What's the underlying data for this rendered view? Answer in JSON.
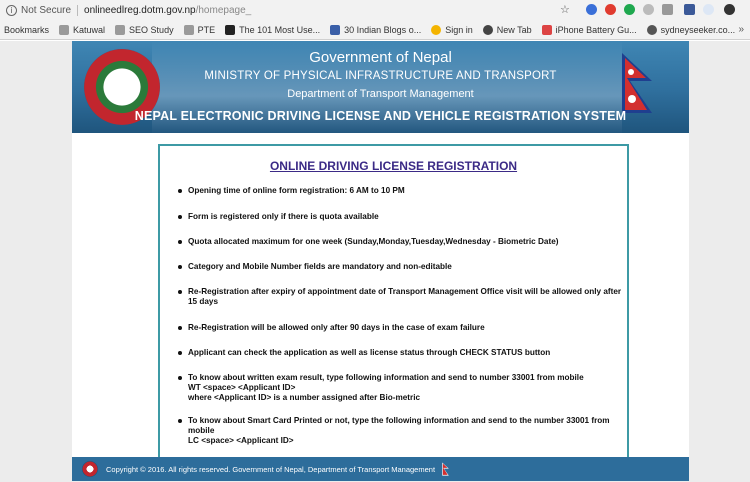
{
  "browser": {
    "not_secure": "Not Secure",
    "url_host": "onlineedlreg.dotm.gov.np",
    "url_path": "/homepage_",
    "bookmarks": [
      {
        "label": "Bookmarks",
        "color": "#ffffff"
      },
      {
        "label": "Katuwal",
        "color": "#8a8a8a"
      },
      {
        "label": "SEO Study",
        "color": "#8a8a8a"
      },
      {
        "label": "PTE",
        "color": "#8a8a8a"
      },
      {
        "label": "The 101 Most Use...",
        "color": "#222222"
      },
      {
        "label": "30 Indian Blogs o...",
        "color": "#3a5fa8"
      },
      {
        "label": "Sign in",
        "color": "#f4b400"
      },
      {
        "label": "New Tab",
        "color": "#444444"
      },
      {
        "label": "iPhone Battery Gu...",
        "color": "#d44"
      },
      {
        "label": "sydneyseeker.co...",
        "color": "#555555"
      }
    ]
  },
  "banner": {
    "government": "Government of Nepal",
    "ministry": "MINISTRY OF PHYSICAL INFRASTRUCTURE AND TRANSPORT",
    "department": "Department of Transport Management",
    "system": "NEPAL ELECTRONIC DRIVING LICENSE AND VEHICLE REGISTRATION SYSTEM"
  },
  "panel": {
    "title": "ONLINE DRIVING LICENSE REGISTRATION",
    "items": [
      "Opening time of online form registration: 6 AM to 10 PM",
      "Form is registered only if there is quota available",
      "Quota allocated maximum for one week (Sunday,Monday,Tuesday,Wednesday - Biometric Date)",
      "Category and Mobile Number fields are mandatory and non-editable",
      "Re-Registration after expiry of appointment date of Transport Management Office visit will be allowed only after 15 days",
      "Re-Registration will be allowed only after 90 days in the case of exam failure",
      "Applicant can check the application as well as license status through CHECK STATUS button",
      "To know about written exam result, type following information and send to number 33001 from mobile\nWT <space> <Applicant ID>\nwhere <Applicant ID> is a number assigned after Bio-metric",
      "To know about Smart Card Printed or not, type the following information and send to the number 33001 from mobile\nLC <space> <Applicant ID>"
    ]
  },
  "footer": {
    "copyright": "Copyright © 2016. All rights reserved. Government of Nepal, Department of Transport Management"
  }
}
